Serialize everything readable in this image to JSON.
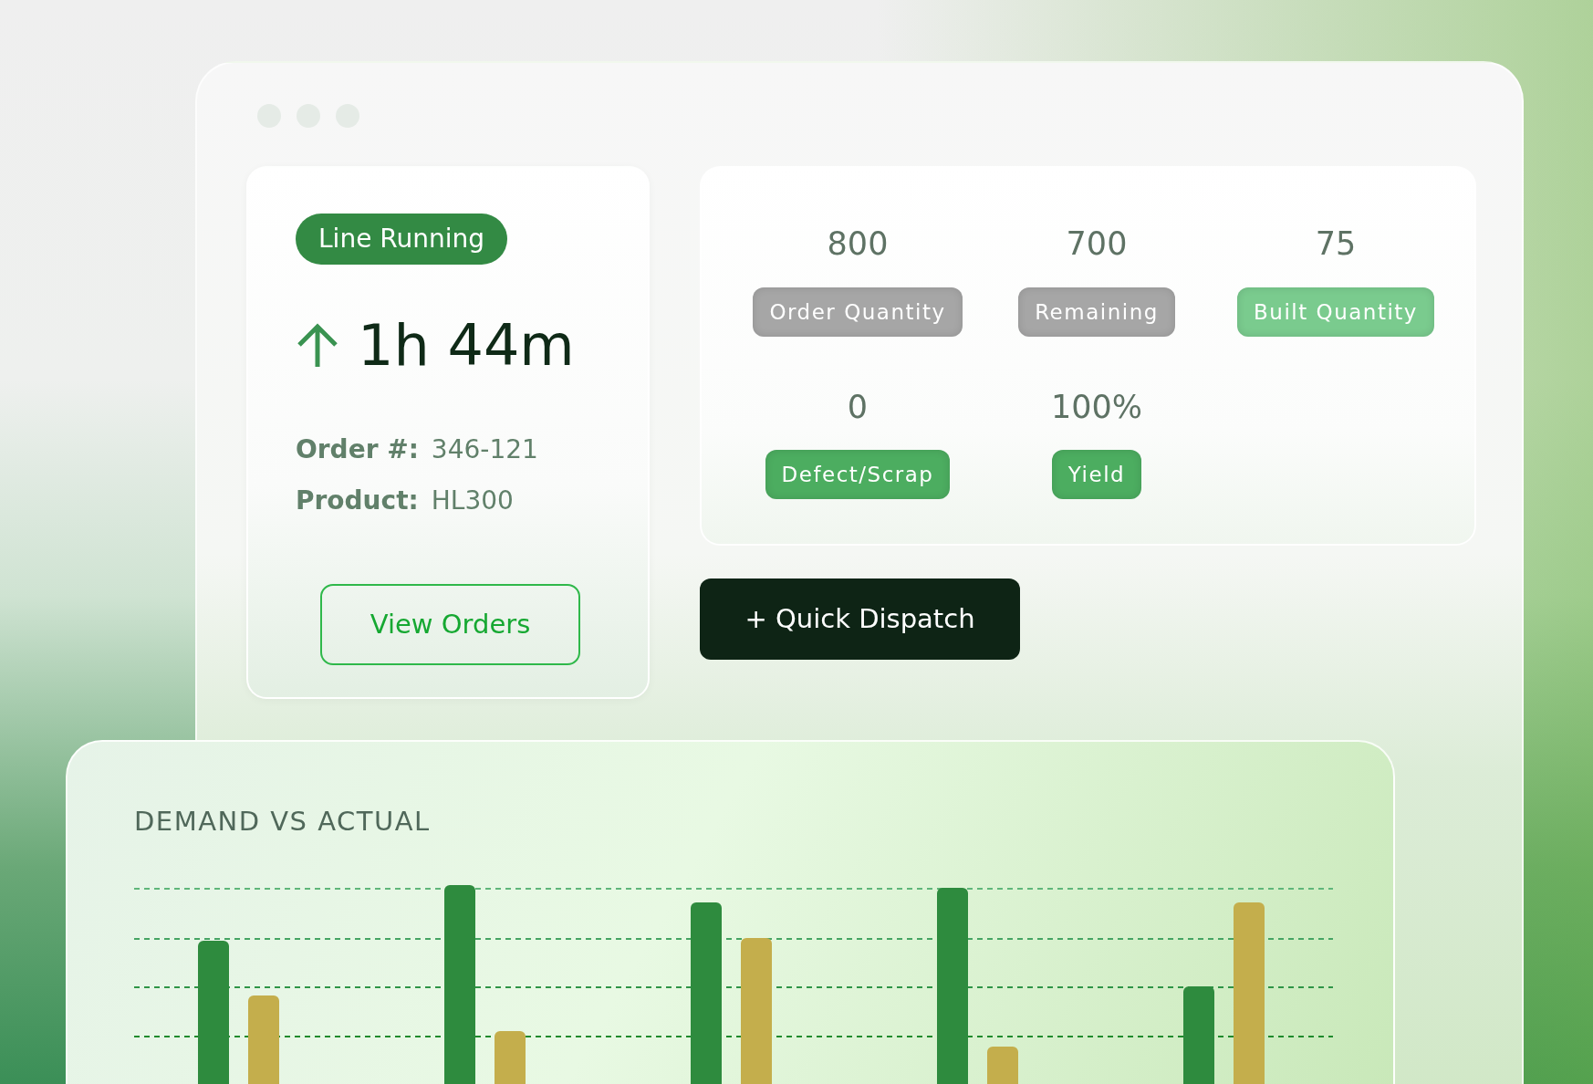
{
  "status": {
    "label": "Line Running",
    "running": true
  },
  "elapsed": {
    "value": "1h 44m"
  },
  "order_info": [
    {
      "label": "Order #:",
      "value": "346-121"
    },
    {
      "label": "Product:",
      "value": "HL300"
    }
  ],
  "view_orders_button": "View Orders",
  "stats": [
    {
      "value": "800",
      "label": "Order Quantity",
      "color": "#a6a6a6"
    },
    {
      "value": "700",
      "label": "Remaining",
      "color": "#a6a6a6"
    },
    {
      "value": "75",
      "label": "Built Quantity",
      "color": "#7acb8e"
    },
    {
      "value": "0",
      "label": "Defect/Scrap",
      "color": "#4cad60"
    },
    {
      "value": "100%",
      "label": "Yield",
      "color": "#4cad60"
    }
  ],
  "quick_dispatch_button": "+ Quick Dispatch",
  "chart": {
    "title": "DEMAND VS ACTUAL"
  }
}
